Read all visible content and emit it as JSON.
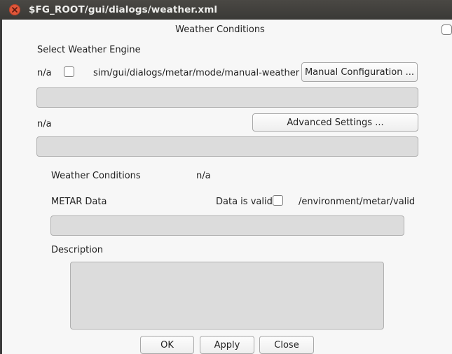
{
  "window": {
    "title": "$FG_ROOT/gui/dialogs/weather.xml",
    "close_icon": "close-icon"
  },
  "dialog": {
    "heading": "Weather Conditions",
    "engine_section_label": "Select Weather Engine",
    "engine_value": "n/a",
    "manual_weather_property": "sim/gui/dialogs/metar/mode/manual-weather",
    "manual_config_button": "Manual Configuration ...",
    "advanced_value": "n/a",
    "advanced_settings_button": "Advanced Settings ...",
    "weather_conditions_label": "Weather Conditions",
    "weather_conditions_value": "n/a",
    "metar_label": "METAR Data",
    "data_valid_label": "Data is valid",
    "data_valid_property": "/environment/metar/valid",
    "description_label": "Description",
    "ok_button": "OK",
    "apply_button": "Apply",
    "close_button": "Close"
  },
  "colors": {
    "titlebar": "#3f3e3a",
    "close_button": "#e2573a",
    "dialog_bg": "#f7f7f7",
    "field_bg": "#dcdcdc"
  }
}
